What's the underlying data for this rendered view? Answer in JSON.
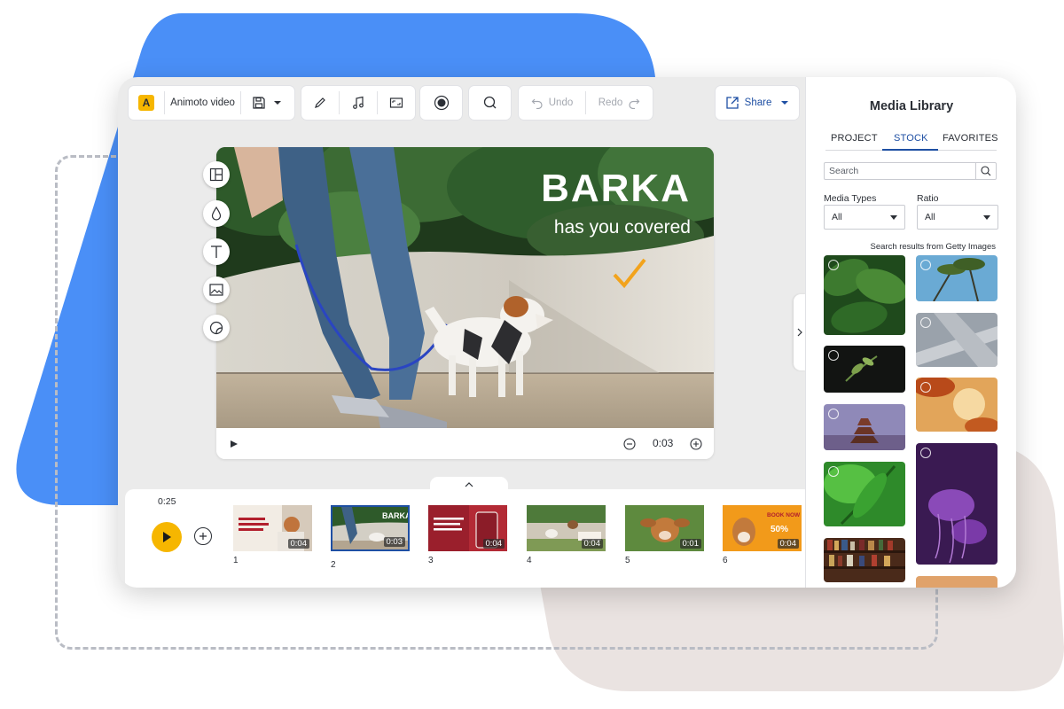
{
  "toolbar": {
    "logo_letter": "A",
    "project_title": "Animoto video",
    "undo_label": "Undo",
    "redo_label": "Redo",
    "share_label": "Share"
  },
  "canvas": {
    "headline": "BARKA",
    "subline": "has you covered",
    "time": "0:03"
  },
  "timeline": {
    "total_duration": "0:25",
    "blocks": [
      {
        "number": "1",
        "duration": "0:04"
      },
      {
        "number": "2",
        "duration": "0:03",
        "selected": true
      },
      {
        "number": "3",
        "duration": "0:04"
      },
      {
        "number": "4",
        "duration": "0:04"
      },
      {
        "number": "5",
        "duration": "0:01"
      },
      {
        "number": "6",
        "duration": "0:04"
      }
    ],
    "block6_text": "BOOK NOW",
    "block6_percent": "50%"
  },
  "media_library": {
    "title": "Media Library",
    "tabs": [
      "PROJECT",
      "STOCK",
      "FAVORITES"
    ],
    "active_tab": "STOCK",
    "search_placeholder": "Search",
    "media_types_label": "Media Types",
    "media_types_value": "All",
    "ratio_label": "Ratio",
    "ratio_value": "All",
    "results_note": "Search results from Getty Images"
  },
  "colors": {
    "accent_blue": "#1e4fa3",
    "brand_yellow": "#f6b600",
    "bg_blue": "#4a8ff7",
    "bg_tan": "#eae3e1"
  }
}
